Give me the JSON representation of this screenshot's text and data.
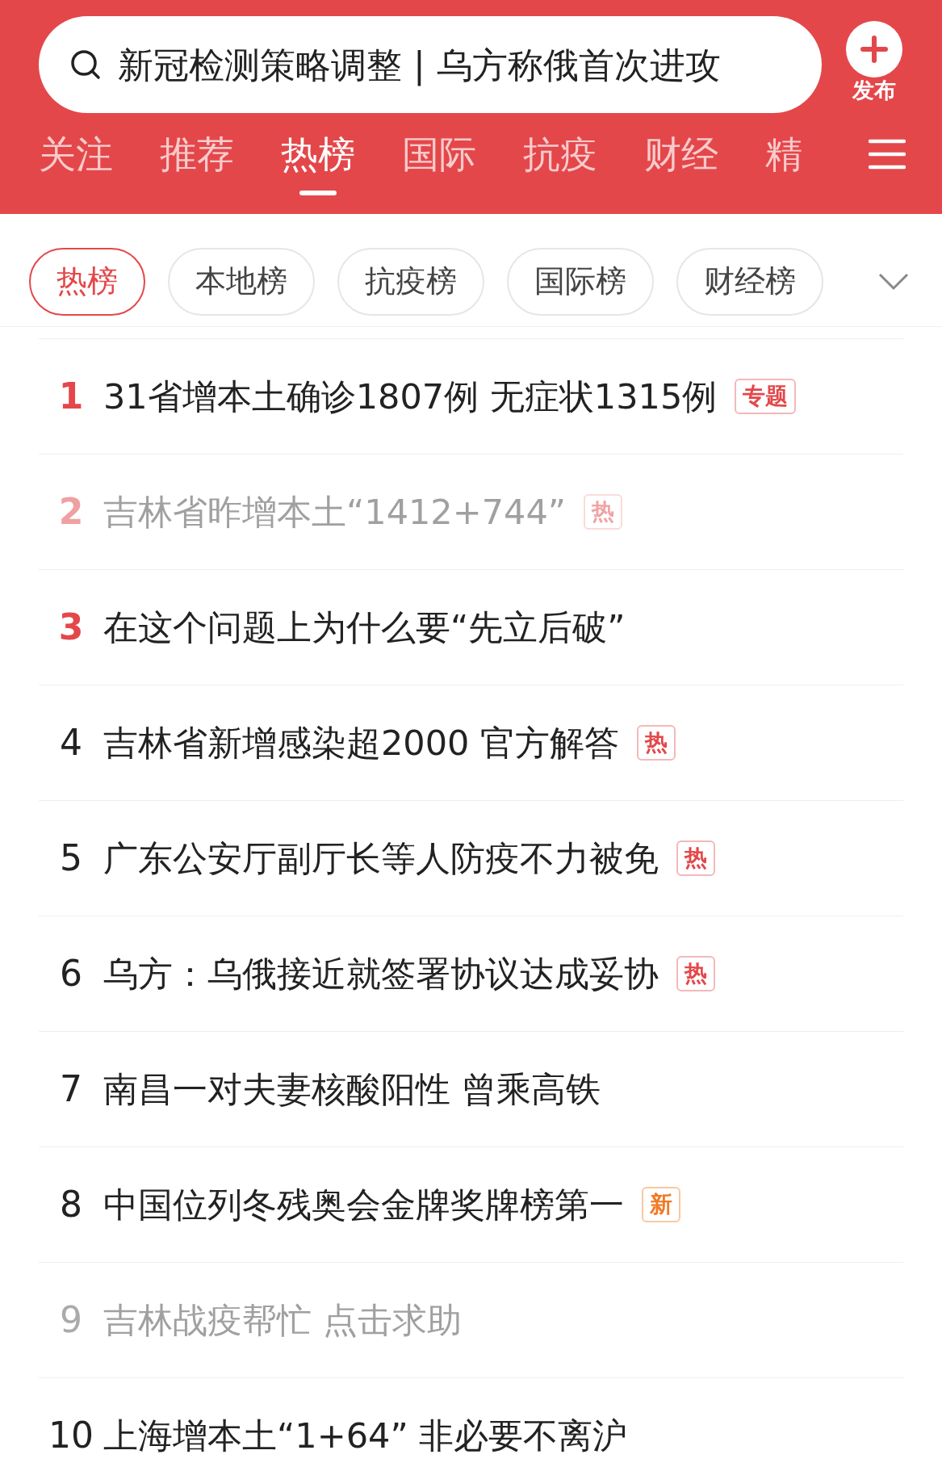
{
  "search": {
    "placeholder": "新冠检测策略调整 | 乌方称俄首次进攻"
  },
  "publish_button": {
    "label": "发布"
  },
  "tabs": [
    {
      "label": "关注",
      "selected": false
    },
    {
      "label": "推荐",
      "selected": false
    },
    {
      "label": "热榜",
      "selected": true
    },
    {
      "label": "国际",
      "selected": false
    },
    {
      "label": "抗疫",
      "selected": false
    },
    {
      "label": "财经",
      "selected": false
    },
    {
      "label": "精",
      "selected": false
    }
  ],
  "chips": [
    {
      "label": "热榜",
      "selected": true
    },
    {
      "label": "本地榜",
      "selected": false
    },
    {
      "label": "抗疫榜",
      "selected": false
    },
    {
      "label": "国际榜",
      "selected": false
    },
    {
      "label": "财经榜",
      "selected": false
    }
  ],
  "items": [
    {
      "rank": "1",
      "top": true,
      "visited": false,
      "title": "31省增本土确诊1807例 无症状1315例",
      "badge": {
        "kind": "topic",
        "text": "专题"
      }
    },
    {
      "rank": "2",
      "top": true,
      "visited": true,
      "title": "吉林省昨增本土“1412+744”",
      "badge": {
        "kind": "hot",
        "text": "热"
      }
    },
    {
      "rank": "3",
      "top": true,
      "visited": false,
      "title": "在这个问题上为什么要“先立后破”"
    },
    {
      "rank": "4",
      "top": false,
      "visited": false,
      "title": "吉林省新增感染超2000 官方解答",
      "badge": {
        "kind": "hot",
        "text": "热"
      }
    },
    {
      "rank": "5",
      "top": false,
      "visited": false,
      "title": "广东公安厅副厅长等人防疫不力被免",
      "badge": {
        "kind": "hot",
        "text": "热"
      }
    },
    {
      "rank": "6",
      "top": false,
      "visited": false,
      "title": "乌方：乌俄接近就签署协议达成妥协",
      "badge": {
        "kind": "hot",
        "text": "热"
      }
    },
    {
      "rank": "7",
      "top": false,
      "visited": false,
      "title": "南昌一对夫妻核酸阳性 曾乘高铁"
    },
    {
      "rank": "8",
      "top": false,
      "visited": false,
      "title": "中国位列冬残奥会金牌奖牌榜第一",
      "badge": {
        "kind": "new",
        "text": "新"
      }
    },
    {
      "rank": "9",
      "top": false,
      "visited": true,
      "title": "吉林战疫帮忙 点击求助"
    },
    {
      "rank": "10",
      "top": false,
      "visited": false,
      "title": "上海增本土“1+64” 非必要不离沪"
    }
  ]
}
